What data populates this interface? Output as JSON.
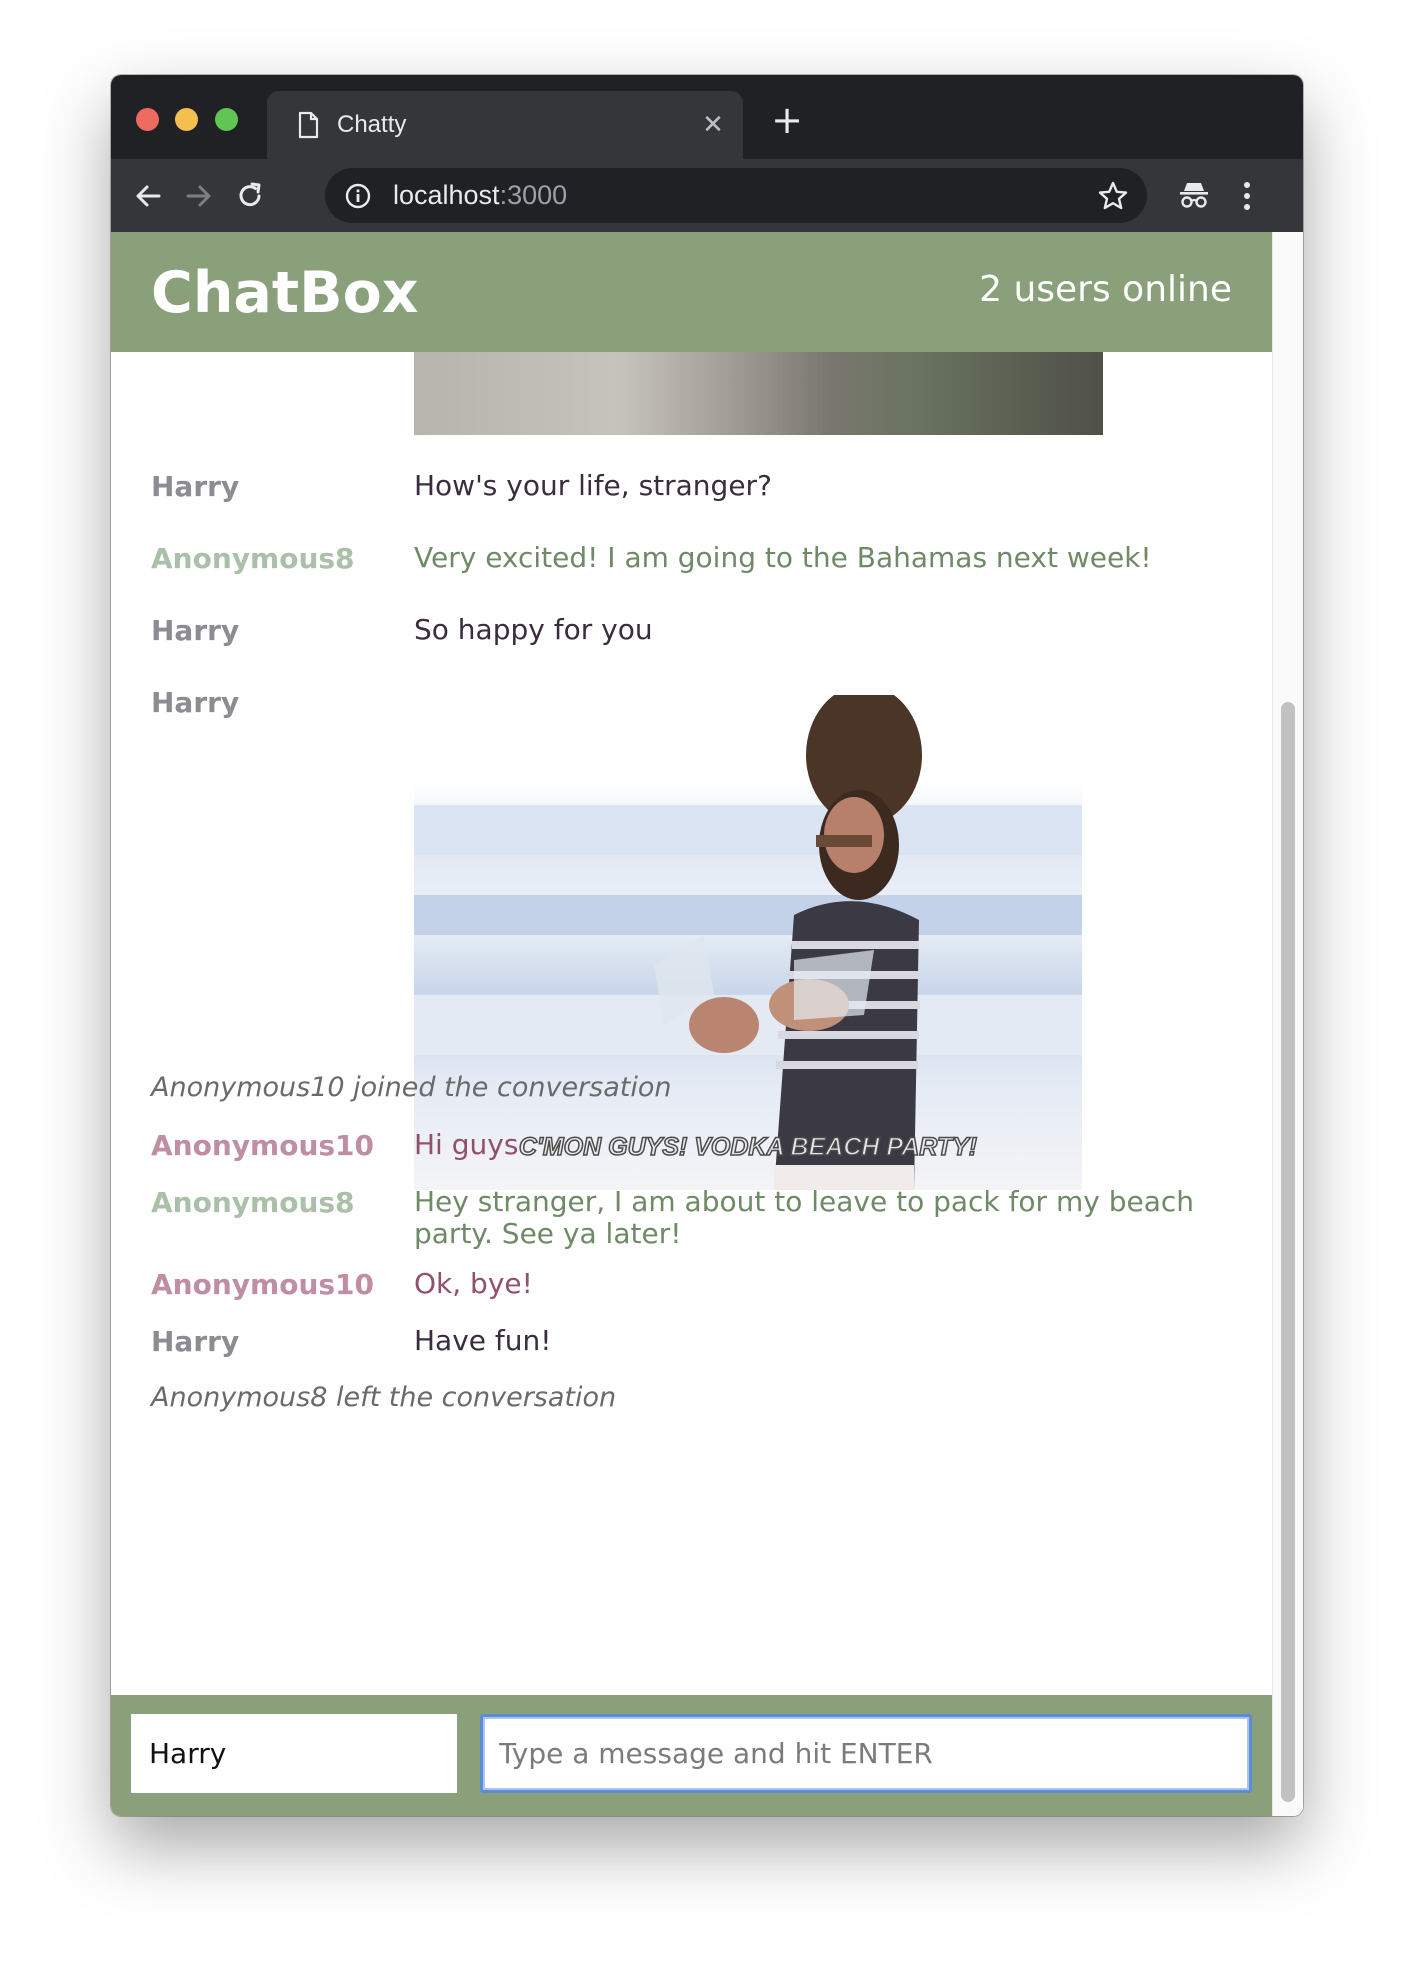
{
  "browser": {
    "tab_title": "Chatty",
    "url_host": "localhost",
    "url_port": ":3000"
  },
  "navbar": {
    "brand": "ChatBox",
    "users_online": "2 users online"
  },
  "messages": [
    {
      "type": "message",
      "user": "Harry",
      "text": "How's your life, stranger?"
    },
    {
      "type": "message",
      "user": "Anonymous8",
      "text": "Very excited! I am going to the Bahamas next week!"
    },
    {
      "type": "message",
      "user": "Harry",
      "text": "So happy for you"
    },
    {
      "type": "image",
      "user": "Harry",
      "caption": "C'MON GUYS! VODKA BEACH PARTY!"
    },
    {
      "type": "system",
      "text": "Anonymous10 joined the conversation"
    },
    {
      "type": "message",
      "user": "Anonymous10",
      "text": "Hi guys"
    },
    {
      "type": "message",
      "user": "Anonymous8",
      "text": "Hey stranger, I am about to leave to pack for my beach party. See ya later!"
    },
    {
      "type": "message",
      "user": "Anonymous10",
      "text": "Ok, bye!"
    },
    {
      "type": "message",
      "user": "Harry",
      "text": "Have fun!"
    },
    {
      "type": "system",
      "text": "Anonymous8 left the conversation"
    }
  ],
  "composer": {
    "username_value": "Harry",
    "message_placeholder": "Type a message and hit ENTER"
  },
  "colors": {
    "header_green": "#89a07a",
    "anonymous8": "#6f8a66",
    "anonymous10": "#92506c"
  }
}
